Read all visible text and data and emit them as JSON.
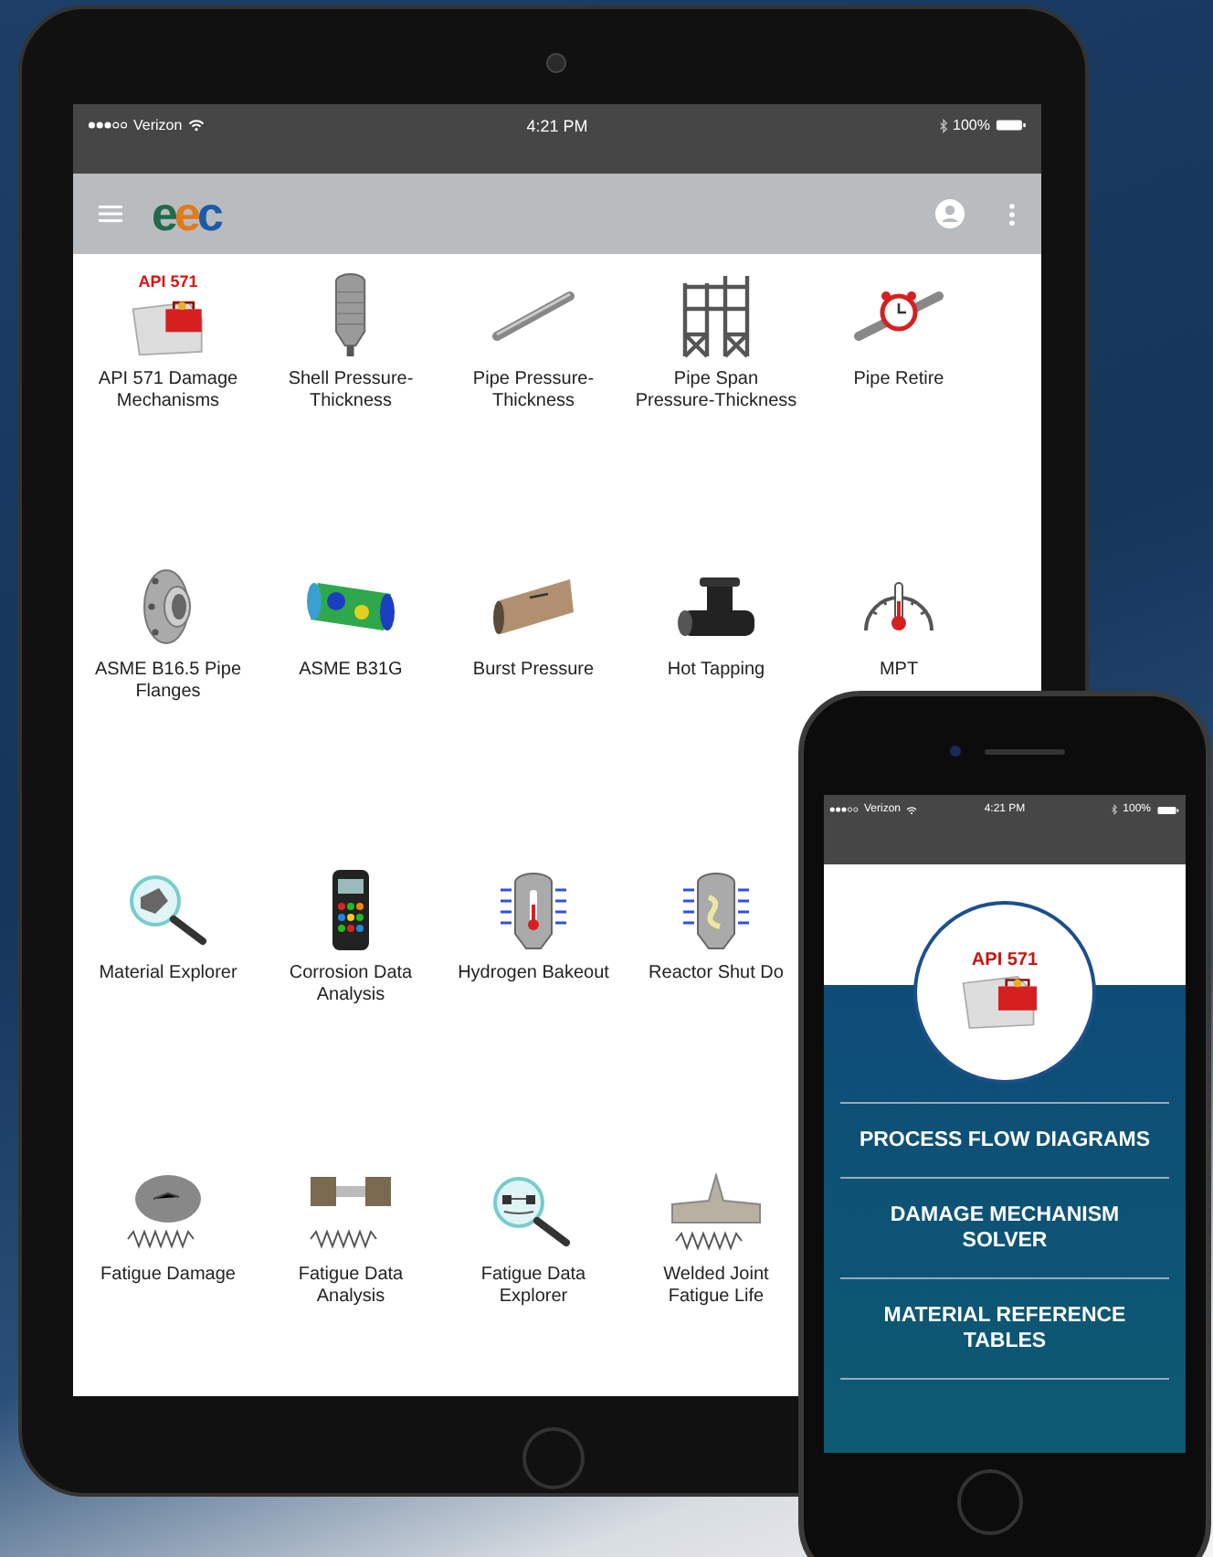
{
  "tablet": {
    "status_bar": {
      "carrier": "Verizon",
      "time": "4:21 PM",
      "battery": "100%"
    },
    "app_bar": {
      "logo": "eec"
    },
    "tile_rows": [
      [
        {
          "label": "API 571 Damage\nMechanisms",
          "caption": "API 571"
        },
        {
          "label": "Shell Pressure-\nThickness"
        },
        {
          "label": "Pipe Pressure-\nThickness"
        },
        {
          "label": "Pipe Span\nPressure-Thickness"
        },
        {
          "label": "Pipe Retire"
        }
      ],
      [
        {
          "label": "ASME B16.5 Pipe\nFlanges"
        },
        {
          "label": "ASME B31G"
        },
        {
          "label": "Burst Pressure"
        },
        {
          "label": "Hot Tapping"
        },
        {
          "label": "MPT"
        }
      ],
      [
        {
          "label": "Material Explorer"
        },
        {
          "label": "Corrosion Data\nAnalysis"
        },
        {
          "label": "Hydrogen Bakeout"
        },
        {
          "label": "Reactor Shut Do"
        }
      ],
      [
        {
          "label": "Fatigue Damage"
        },
        {
          "label": "Fatigue Data\nAnalysis"
        },
        {
          "label": "Fatigue Data\nExplorer"
        },
        {
          "label": "Welded Joint\nFatigue Life"
        }
      ]
    ]
  },
  "phone": {
    "status_bar": {
      "carrier": "Verizon",
      "time": "4:21 PM",
      "battery": "100%"
    },
    "logo_caption": "API 571",
    "menu": [
      "PROCESS FLOW DIAGRAMS",
      "DAMAGE MECHANISM\nSOLVER",
      "MATERIAL REFERENCE\nTABLES"
    ]
  }
}
